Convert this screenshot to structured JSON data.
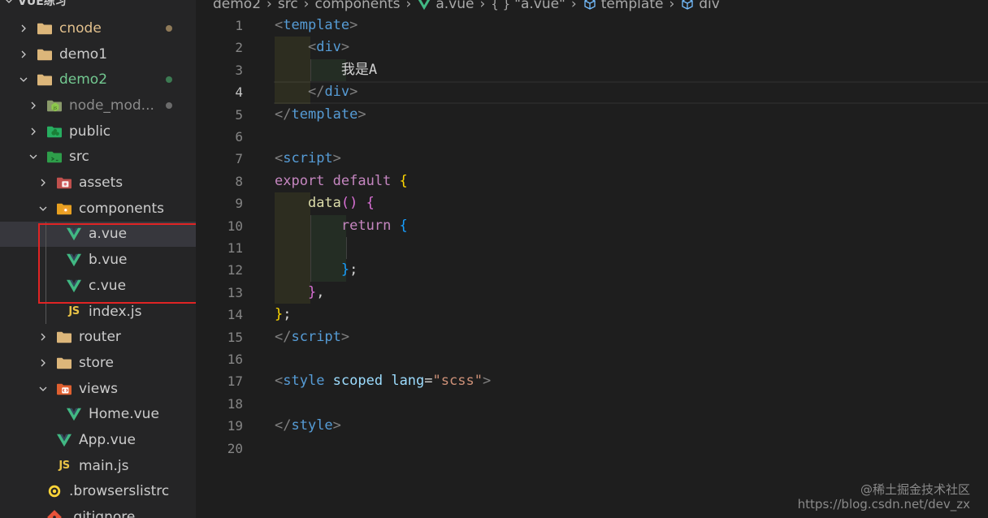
{
  "explorer": {
    "root_label": "VUE练习",
    "items": [
      {
        "label": "cnode",
        "depth": 0,
        "kind": "folder",
        "chevron": "right",
        "status": "modified"
      },
      {
        "label": "demo1",
        "depth": 0,
        "kind": "folder",
        "chevron": "right",
        "status": "none"
      },
      {
        "label": "demo2",
        "depth": 0,
        "kind": "folder",
        "chevron": "down",
        "status": "untracked"
      },
      {
        "label": "node_mod...",
        "depth": 1,
        "kind": "folder-node",
        "chevron": "right",
        "status": "dim"
      },
      {
        "label": "public",
        "depth": 1,
        "kind": "folder-public",
        "chevron": "right",
        "status": "none"
      },
      {
        "label": "src",
        "depth": 1,
        "kind": "folder-src",
        "chevron": "down",
        "status": "none"
      },
      {
        "label": "assets",
        "depth": 2,
        "kind": "folder-assets",
        "chevron": "right",
        "status": "none"
      },
      {
        "label": "components",
        "depth": 2,
        "kind": "folder-components",
        "chevron": "down",
        "status": "none"
      },
      {
        "label": "a.vue",
        "depth": 3,
        "kind": "vue",
        "chevron": "none",
        "status": "selected"
      },
      {
        "label": "b.vue",
        "depth": 3,
        "kind": "vue",
        "chevron": "none",
        "status": "none"
      },
      {
        "label": "c.vue",
        "depth": 3,
        "kind": "vue",
        "chevron": "none",
        "status": "none"
      },
      {
        "label": "index.js",
        "depth": 3,
        "kind": "js",
        "chevron": "none",
        "status": "none"
      },
      {
        "label": "router",
        "depth": 2,
        "kind": "folder",
        "chevron": "right",
        "status": "none"
      },
      {
        "label": "store",
        "depth": 2,
        "kind": "folder",
        "chevron": "right",
        "status": "none"
      },
      {
        "label": "views",
        "depth": 2,
        "kind": "folder-views",
        "chevron": "down",
        "status": "none"
      },
      {
        "label": "Home.vue",
        "depth": 3,
        "kind": "vue",
        "chevron": "none",
        "status": "none"
      },
      {
        "label": "App.vue",
        "depth": 2,
        "kind": "vue",
        "chevron": "none",
        "status": "none"
      },
      {
        "label": "main.js",
        "depth": 2,
        "kind": "js",
        "chevron": "none",
        "status": "none"
      },
      {
        "label": ".browserslistrc",
        "depth": 1,
        "kind": "browserslist",
        "chevron": "none",
        "status": "none"
      },
      {
        "label": ".gitignore",
        "depth": 1,
        "kind": "git",
        "chevron": "none",
        "status": "none"
      }
    ]
  },
  "breadcrumb": {
    "items": [
      {
        "label": "demo2",
        "icon": "none"
      },
      {
        "label": "src",
        "icon": "none"
      },
      {
        "label": "components",
        "icon": "none"
      },
      {
        "label": "a.vue",
        "icon": "vue-icon"
      },
      {
        "label": "\"a.vue\"",
        "icon": "braces-icon"
      },
      {
        "label": "template",
        "icon": "cube-icon"
      },
      {
        "label": "div",
        "icon": "cube-icon"
      }
    ]
  },
  "editor": {
    "active_line": 4,
    "lines": [
      [
        {
          "t": "<",
          "c": "punct"
        },
        {
          "t": "template",
          "c": "tag"
        },
        {
          "t": ">",
          "c": "punct"
        }
      ],
      [
        {
          "t": "    ",
          "c": "text"
        },
        {
          "t": "<",
          "c": "punct"
        },
        {
          "t": "div",
          "c": "tag"
        },
        {
          "t": ">",
          "c": "punct"
        }
      ],
      [
        {
          "t": "        我是A",
          "c": "text"
        }
      ],
      [
        {
          "t": "    ",
          "c": "text"
        },
        {
          "t": "</",
          "c": "punct"
        },
        {
          "t": "div",
          "c": "tag"
        },
        {
          "t": ">",
          "c": "punct"
        }
      ],
      [
        {
          "t": "</",
          "c": "punct"
        },
        {
          "t": "template",
          "c": "tag"
        },
        {
          "t": ">",
          "c": "punct"
        }
      ],
      [],
      [
        {
          "t": "<",
          "c": "punct"
        },
        {
          "t": "script",
          "c": "tag"
        },
        {
          "t": ">",
          "c": "punct"
        }
      ],
      [
        {
          "t": "export default ",
          "c": "kw"
        },
        {
          "t": "{",
          "c": "brace"
        }
      ],
      [
        {
          "t": "    ",
          "c": "text"
        },
        {
          "t": "data",
          "c": "fn"
        },
        {
          "t": "() {",
          "c": "brace2"
        }
      ],
      [
        {
          "t": "        ",
          "c": "text"
        },
        {
          "t": "return ",
          "c": "kw"
        },
        {
          "t": "{",
          "c": "brace3"
        }
      ],
      [],
      [
        {
          "t": "        ",
          "c": "text"
        },
        {
          "t": "}",
          "c": "brace3"
        },
        {
          "t": ";",
          "c": "text"
        }
      ],
      [
        {
          "t": "    ",
          "c": "text"
        },
        {
          "t": "}",
          "c": "brace2"
        },
        {
          "t": ",",
          "c": "text"
        }
      ],
      [
        {
          "t": "}",
          "c": "brace"
        },
        {
          "t": ";",
          "c": "text"
        }
      ],
      [
        {
          "t": "</",
          "c": "punct"
        },
        {
          "t": "script",
          "c": "tag"
        },
        {
          "t": ">",
          "c": "punct"
        }
      ],
      [],
      [
        {
          "t": "<",
          "c": "punct"
        },
        {
          "t": "style ",
          "c": "tag"
        },
        {
          "t": "scoped ",
          "c": "attr"
        },
        {
          "t": "lang",
          "c": "attr"
        },
        {
          "t": "=",
          "c": "text"
        },
        {
          "t": "\"scss\"",
          "c": "str"
        },
        {
          "t": ">",
          "c": "punct"
        }
      ],
      [],
      [
        {
          "t": "</",
          "c": "punct"
        },
        {
          "t": "style",
          "c": "tag"
        },
        {
          "t": ">",
          "c": "punct"
        }
      ],
      []
    ]
  },
  "watermark": {
    "line1": "@稀土掘金技术社区",
    "line2": "https://blog.csdn.net/dev_zx"
  },
  "colors": {
    "accent_vue": "#41b883",
    "folder": "#dcb67a",
    "modified": "#e2c08d",
    "untracked": "#73c991",
    "highlight_box": "#e02424"
  }
}
